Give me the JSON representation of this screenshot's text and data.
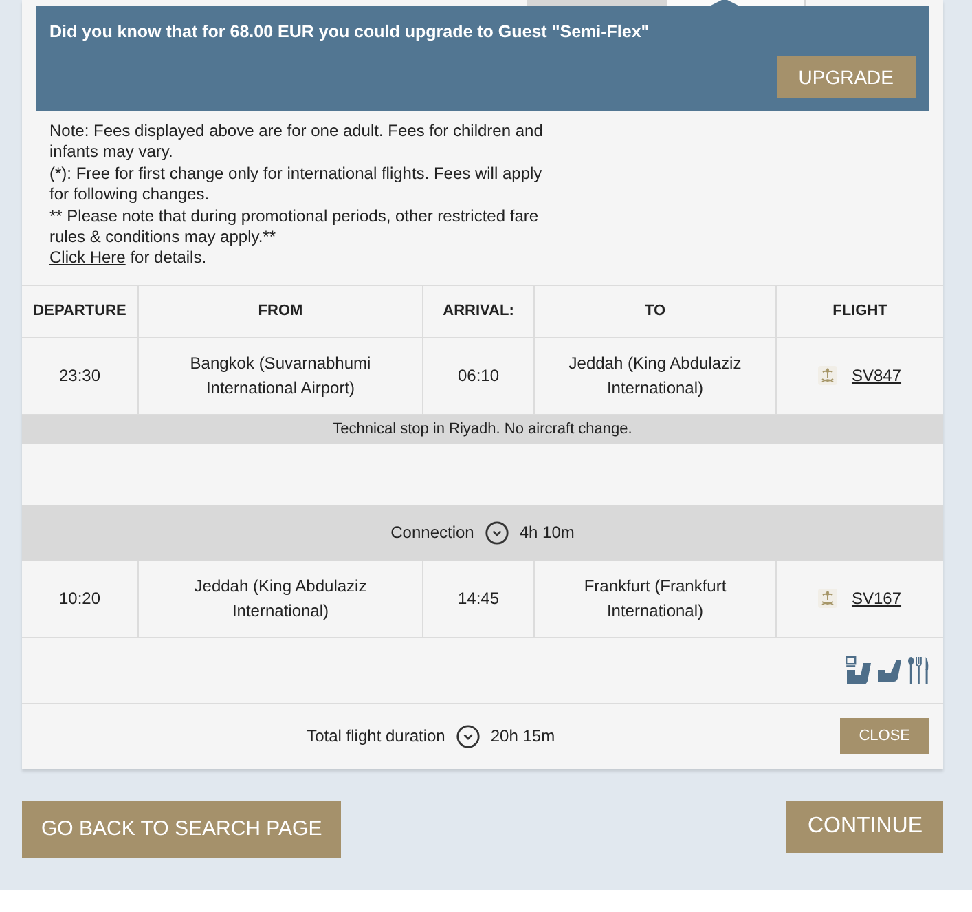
{
  "upgrade_banner": {
    "message": "Did you know that for 68.00 EUR you could upgrade to Guest \"Semi-Flex\"",
    "button": "UPGRADE"
  },
  "notes": {
    "paragraphs": [
      "Note: Fees displayed above are for one adult. Fees for children and infants may vary.",
      "(*): Free for first change only for international flights. Fees will apply for following changes.",
      "** Please note that during promotional periods, other restricted fare rules & conditions may apply.**"
    ],
    "details": {
      "link": "Click Here",
      "text": "for details."
    }
  },
  "itinerary": {
    "columns": [
      "DEPARTURE",
      "FROM",
      "ARRIVAL:",
      "TO",
      "FLIGHT"
    ],
    "rows": [
      {
        "kind": "segment",
        "departure": "23:30",
        "from": "Bangkok (Suvarnabhumi International Airport)",
        "arrival": "06:10",
        "to": "Jeddah (King Abdulaziz International)",
        "flight": "SV847"
      },
      {
        "kind": "stop_note",
        "text": "Technical stop in Riyadh. No aircraft change."
      },
      {
        "kind": "connection",
        "label": "Connection",
        "duration": "4h 10m"
      },
      {
        "kind": "segment",
        "departure": "10:20",
        "from": "Jeddah (King Abdulaziz International)",
        "arrival": "14:45",
        "to": "Frankfurt (Frankfurt International)",
        "flight": "SV167"
      }
    ],
    "total": {
      "label": "Total flight duration",
      "duration": "20h 15m",
      "button": "CLOSE"
    }
  },
  "actions": {
    "back": "GO BACK TO SEARCH PAGE",
    "continue": "CONTINUE"
  }
}
